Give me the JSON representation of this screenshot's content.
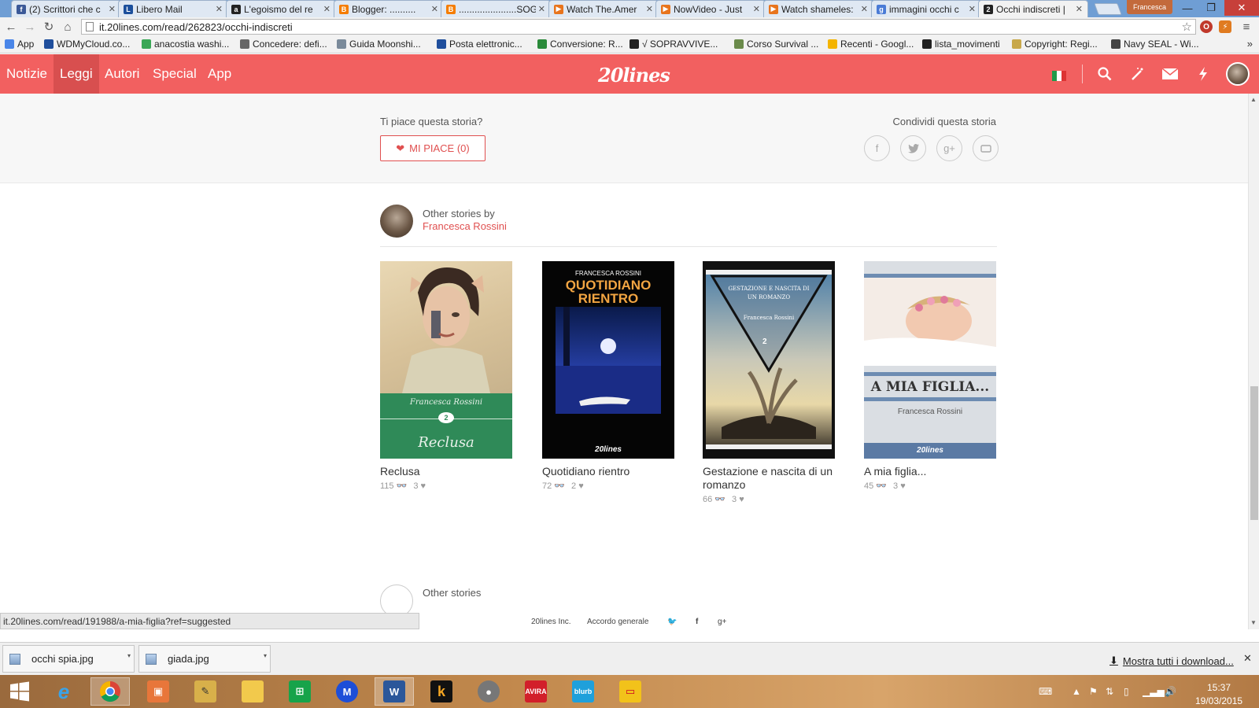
{
  "browser": {
    "tabs": [
      {
        "title": "(2) Scrittori che c",
        "favicon": "facebook-favicon",
        "color": "#3b5998",
        "glyph": "f"
      },
      {
        "title": "Libero Mail",
        "favicon": "libero-favicon",
        "color": "#1b4f9c",
        "glyph": "L"
      },
      {
        "title": "L'egoismo del re",
        "favicon": "amazon-favicon",
        "color": "#222222",
        "glyph": "a"
      },
      {
        "title": "Blogger: ..........",
        "favicon": "blogger-favicon",
        "color": "#f57d00",
        "glyph": "B"
      },
      {
        "title": "......................SOGN",
        "favicon": "blogger-favicon",
        "color": "#f57d00",
        "glyph": "B"
      },
      {
        "title": "Watch The.Amer",
        "favicon": "video-favicon",
        "color": "#e8741c",
        "glyph": "▶"
      },
      {
        "title": "NowVideo - Just",
        "favicon": "video-favicon",
        "color": "#e8741c",
        "glyph": "▶"
      },
      {
        "title": "Watch shameles:",
        "favicon": "video-favicon",
        "color": "#e8741c",
        "glyph": "▶"
      },
      {
        "title": "immagini occhi c",
        "favicon": "google-favicon",
        "color": "#4a7bd6",
        "glyph": "g"
      },
      {
        "title": "Occhi indiscreti |",
        "favicon": "20lines-favicon",
        "color": "#222222",
        "glyph": "2"
      }
    ],
    "profile_name": "Francesca",
    "url": "it.20lines.com/read/262823/occhi-indiscreti",
    "bookmarks": [
      {
        "label": "App",
        "color": "#4a86e8"
      },
      {
        "label": "WDMyCloud.co...",
        "color": "#1f4e9c"
      },
      {
        "label": "anacostia washi...",
        "color": "#3aa757"
      },
      {
        "label": "Concedere: defi...",
        "color": "#666666"
      },
      {
        "label": "Guida Moonshi...",
        "color": "#7a8a9a"
      },
      {
        "label": "Posta elettronic...",
        "color": "#1f4e9c"
      },
      {
        "label": "Conversione: R...",
        "color": "#2a8a3a"
      },
      {
        "label": "√ SOPRAVVIVE...",
        "color": "#222222"
      },
      {
        "label": "Corso Survival ...",
        "color": "#6a8a4a"
      },
      {
        "label": "Recenti - Googl...",
        "color": "#f4b400"
      },
      {
        "label": "lista_movimenti",
        "color": "#222222"
      },
      {
        "label": "Copyright: Regi...",
        "color": "#c8a84a"
      },
      {
        "label": "Navy SEAL - Wi...",
        "color": "#444444"
      }
    ]
  },
  "site": {
    "nav": [
      "Notizie",
      "Leggi",
      "Autori",
      "Special",
      "App"
    ],
    "active_nav": "Leggi",
    "logo": "20lines",
    "brand_color": "#f26060"
  },
  "like_section": {
    "question": "Ti piace questa storia?",
    "like_button": "MI PIACE (0)",
    "share_title": "Condividi questa storia",
    "share_icons": [
      "facebook-icon",
      "twitter-icon",
      "google-plus-icon",
      "embed-icon"
    ]
  },
  "author_section": {
    "heading": "Other stories by",
    "author": "Francesca Rossini"
  },
  "stories": [
    {
      "title": "Reclusa",
      "reads": "115",
      "likes": "3",
      "cover_author": "Francesca Rossini",
      "cover_title": "Reclusa"
    },
    {
      "title": "Quotidiano rientro",
      "reads": "72",
      "likes": "2",
      "cover_author": "FRANCESCA ROSSINI",
      "cover_title": "QUOTIDIANO RIENTRO"
    },
    {
      "title": "Gestazione e nascita di un romanzo",
      "reads": "66",
      "likes": "3",
      "cover_author": "Francesca Rossini",
      "cover_title": "GESTAZIONE E NASCITA DI UN ROMANZO"
    },
    {
      "title": "A mia figlia...",
      "reads": "45",
      "likes": "3",
      "cover_author": "Francesca Rossini",
      "cover_title": "A MIA FIGLIA..."
    }
  ],
  "other_stories": "Other stories",
  "footer": {
    "company": "20lines Inc.",
    "agreement": "Accordo generale"
  },
  "status_url": "it.20lines.com/read/191988/a-mia-figlia?ref=suggested",
  "downloads": {
    "items": [
      "occhi spia.jpg",
      "giada.jpg"
    ],
    "show_all": "Mostra tutti i download..."
  },
  "taskbar": {
    "time": "15:37",
    "date": "19/03/2015"
  }
}
